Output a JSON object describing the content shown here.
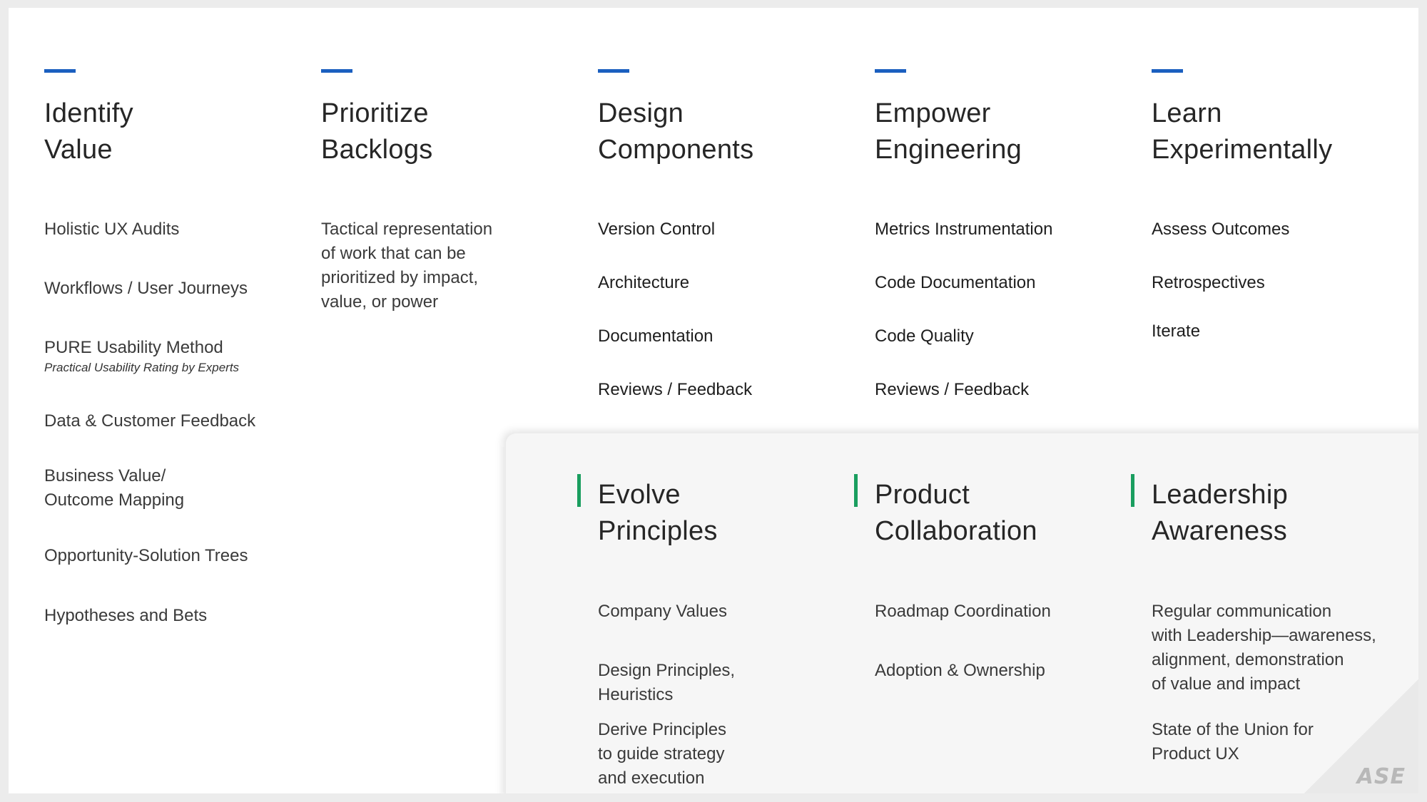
{
  "top_columns": [
    {
      "title_line1": "Identify",
      "title_line2": "Value",
      "items": [
        "Holistic UX Audits",
        "Workflows / User Journeys",
        "PURE Usability Method",
        "Data & Customer Feedback",
        "Business Value/",
        "Outcome Mapping",
        "Opportunity-Solution Trees",
        "Hypotheses and Bets"
      ],
      "pure_subtitle": "Practical Usability Rating by Experts"
    },
    {
      "title_line1": "Prioritize",
      "title_line2": "Backlogs",
      "description": [
        "Tactical representation",
        "of work that can be",
        "prioritized by impact,",
        "value, or power"
      ]
    },
    {
      "title_line1": "Design",
      "title_line2": "Components",
      "items": [
        "Version Control",
        "Architecture",
        "Documentation",
        "Reviews / Feedback"
      ]
    },
    {
      "title_line1": "Empower",
      "title_line2": "Engineering",
      "items": [
        "Metrics Instrumentation",
        "Code Documentation",
        "Code Quality",
        "Reviews / Feedback"
      ]
    },
    {
      "title_line1": "Learn",
      "title_line2": "Experimentally",
      "items": [
        "Assess Outcomes",
        "Retrospectives",
        "Iterate"
      ]
    }
  ],
  "bottom_columns": [
    {
      "title_line1": "Evolve",
      "title_line2": "Principles",
      "items": [
        "Company Values",
        "Design Principles,",
        "Heuristics",
        "Derive Principles",
        "to guide strategy",
        "and execution"
      ]
    },
    {
      "title_line1": "Product",
      "title_line2": "Collaboration",
      "items": [
        "Roadmap Coordination",
        "Adoption & Ownership"
      ]
    },
    {
      "title_line1": "Leadership",
      "title_line2": "Awareness",
      "items": [
        "Regular communication",
        "with Leadership—awareness,",
        "alignment, demonstration",
        "of value and impact",
        "State of the Union for",
        "Product UX"
      ]
    }
  ],
  "logo_text": "ASE",
  "colors": {
    "top_accent": "#1b5fbf",
    "bottom_accent": "#1a9e5f",
    "panel_bg": "#f6f6f6"
  }
}
